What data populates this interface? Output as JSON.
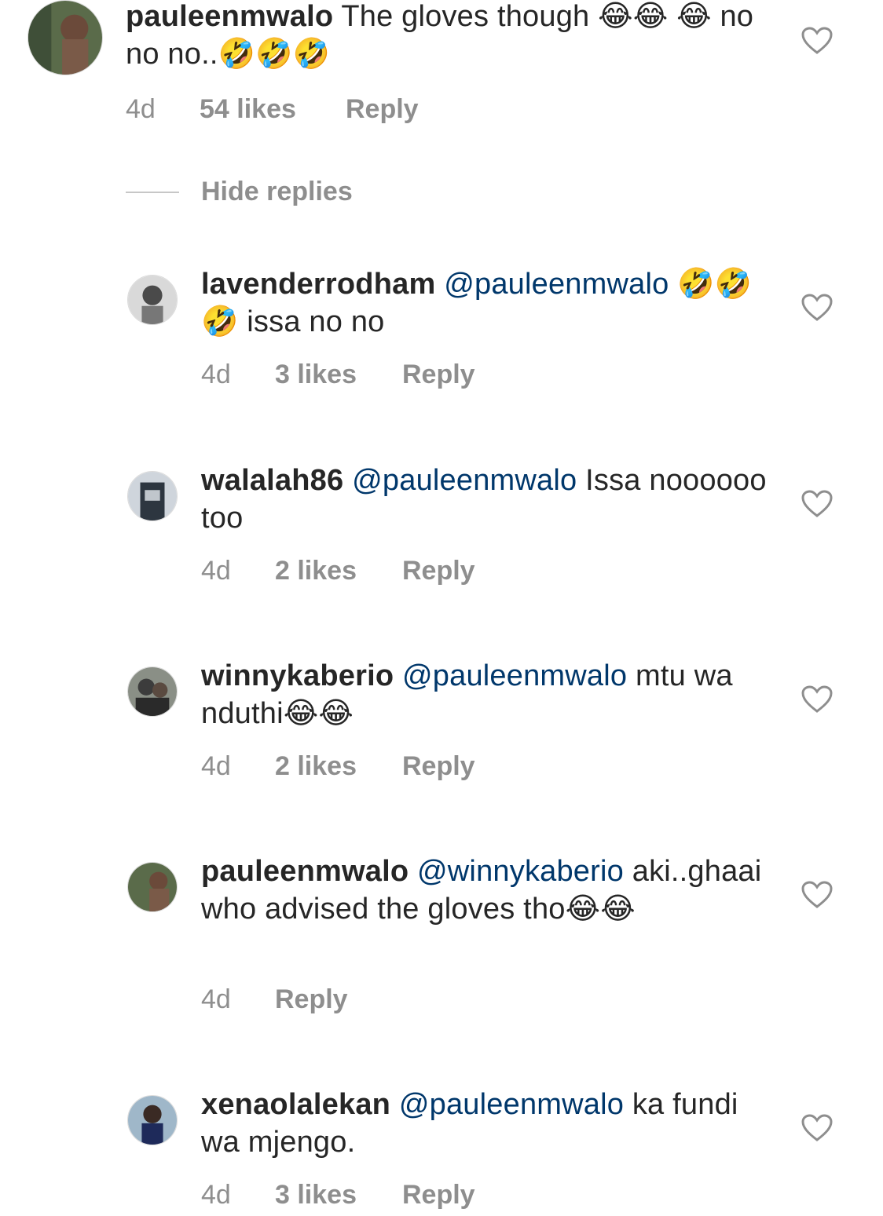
{
  "top_comment": {
    "username": "pauleenmwalo",
    "text": "The gloves though 😂😂 😂 no no no..🤣🤣🤣",
    "time": "4d",
    "likes": "54 likes",
    "reply_label": "Reply"
  },
  "hide_replies_label": "Hide replies",
  "replies": [
    {
      "username": "lavenderrodham",
      "mention": "@pauleenmwalo",
      "text": " 🤣🤣🤣 issa no no",
      "time": "4d",
      "likes": "3 likes",
      "reply_label": "Reply"
    },
    {
      "username": "walalah86",
      "mention": "@pauleenmwalo",
      "text": " Issa noooooo too",
      "time": "4d",
      "likes": "2 likes",
      "reply_label": "Reply"
    },
    {
      "username": "winnykaberio",
      "mention": "@pauleenmwalo",
      "text": "  mtu wa nduthi😂😂",
      "time": "4d",
      "likes": "2 likes",
      "reply_label": "Reply"
    },
    {
      "username": "pauleenmwalo",
      "mention": "@winnykaberio",
      "text": " aki..ghaai who advised the gloves tho😂😂",
      "time": "4d",
      "likes": "",
      "reply_label": "Reply"
    },
    {
      "username": "xenaolalekan",
      "mention": "@pauleenmwalo",
      "text": " ka fundi wa mjengo.",
      "time": "4d",
      "likes": "3 likes",
      "reply_label": "Reply"
    }
  ],
  "colors": {
    "text": "#262626",
    "mention": "#00376b",
    "secondary": "#8e8e8e",
    "divider": "#c7c7c7"
  },
  "icons": {
    "like": "heart-outline-icon"
  }
}
